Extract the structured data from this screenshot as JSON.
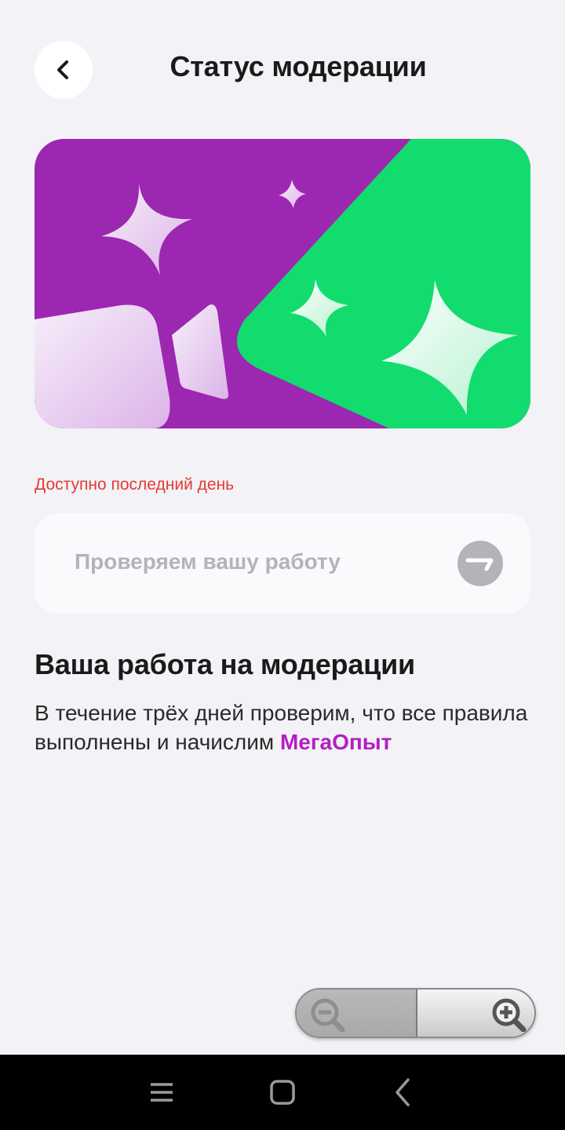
{
  "header": {
    "title": "Статус модерации",
    "back_icon": "chevron-left-icon"
  },
  "banner": {
    "colors": {
      "purple": "#9c27b0",
      "green": "#12dc6e"
    }
  },
  "deadline": {
    "text": "Доступно последний день",
    "color": "#e53935"
  },
  "status": {
    "text": "Проверяем вашу работу",
    "icon": "clock-icon"
  },
  "info": {
    "title": "Ваша работа на модерации",
    "body_text": "В течение трёх дней проверим, что все правила выполнены и начислим ",
    "accent_text": "МегаОпыт",
    "accent_color": "#b41ec3"
  },
  "zoom": {
    "out_icon": "zoom-out-icon",
    "in_icon": "zoom-in-icon"
  },
  "navbar": {
    "menu_icon": "menu-icon",
    "home_icon": "home-icon",
    "back_icon": "back-icon"
  }
}
